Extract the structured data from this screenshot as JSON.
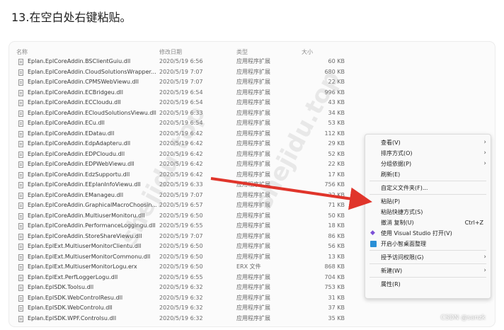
{
  "heading": "13.在空白处右键粘贴。",
  "columns": {
    "name": "名称",
    "date": "修改日期",
    "type": "类型",
    "size": "大小"
  },
  "files": [
    {
      "name": "Eplan.EplCoreAddin.BSClientGuiu.dll",
      "date": "2020/5/19 6:56",
      "type": "应用程序扩展",
      "size": "60 KB"
    },
    {
      "name": "Eplan.EplCoreAddin.CloudSolutionsWrapper...",
      "date": "2020/5/19 7:07",
      "type": "应用程序扩展",
      "size": "680 KB"
    },
    {
      "name": "Eplan.EplCoreAddin.CPMSWebViewu.dll",
      "date": "2020/5/19 7:07",
      "type": "应用程序扩展",
      "size": "22 KB"
    },
    {
      "name": "Eplan.EplCoreAddin.ECBridgeu.dll",
      "date": "2020/5/19 6:54",
      "type": "应用程序扩展",
      "size": "996 KB"
    },
    {
      "name": "Eplan.EplCoreAddin.ECCloudu.dll",
      "date": "2020/5/19 6:54",
      "type": "应用程序扩展",
      "size": "43 KB"
    },
    {
      "name": "Eplan.EplCoreAddin.ECloudSolutionsViewu.dll",
      "date": "2020/5/19 6:33",
      "type": "应用程序扩展",
      "size": "34 KB"
    },
    {
      "name": "Eplan.EplCoreAddin.ECu.dll",
      "date": "2020/5/19 6:54",
      "type": "应用程序扩展",
      "size": "53 KB"
    },
    {
      "name": "Eplan.EplCoreAddin.EDatau.dll",
      "date": "2020/5/19 6:42",
      "type": "应用程序扩展",
      "size": "112 KB"
    },
    {
      "name": "Eplan.EplCoreAddin.EdpAdapteru.dll",
      "date": "2020/5/19 6:42",
      "type": "应用程序扩展",
      "size": "29 KB"
    },
    {
      "name": "Eplan.EplCoreAddin.EDPCloudu.dll",
      "date": "2020/5/19 6:42",
      "type": "应用程序扩展",
      "size": "52 KB"
    },
    {
      "name": "Eplan.EplCoreAddin.EDPWebViewu.dll",
      "date": "2020/5/19 6:42",
      "type": "应用程序扩展",
      "size": "22 KB"
    },
    {
      "name": "Eplan.EplCoreAddin.EdzSupportu.dll",
      "date": "2020/5/19 6:42",
      "type": "应用程序扩展",
      "size": "17 KB"
    },
    {
      "name": "Eplan.EplCoreAddin.EEplanInfoViewu.dll",
      "date": "2020/5/19 6:33",
      "type": "应用程序扩展",
      "size": "756 KB"
    },
    {
      "name": "Eplan.EplCoreAddin.EManageu.dll",
      "date": "2020/5/19 7:07",
      "type": "应用程序扩展",
      "size": "32 KB"
    },
    {
      "name": "Eplan.EplCoreAddin.GraphicalMacroChoosin...",
      "date": "2020/5/19 6:57",
      "type": "应用程序扩展",
      "size": "71 KB"
    },
    {
      "name": "Eplan.EplCoreAddin.MultiuserMonitoru.dll",
      "date": "2020/5/19 6:50",
      "type": "应用程序扩展",
      "size": "50 KB"
    },
    {
      "name": "Eplan.EplCoreAddin.PerformanceLoggingu.dll",
      "date": "2020/5/19 6:55",
      "type": "应用程序扩展",
      "size": "18 KB"
    },
    {
      "name": "Eplan.EplCoreAddin.StoreShareViewu.dll",
      "date": "2020/5/19 7:07",
      "type": "应用程序扩展",
      "size": "86 KB"
    },
    {
      "name": "Eplan.EplExt.MultiuserMonitorClientu.dll",
      "date": "2020/5/19 6:50",
      "type": "应用程序扩展",
      "size": "56 KB"
    },
    {
      "name": "Eplan.EplExt.MultiuserMonitorCommonu.dll",
      "date": "2020/5/19 6:50",
      "type": "应用程序扩展",
      "size": "13 KB"
    },
    {
      "name": "Eplan.EplExt.MultiuserMonitorLogu.erx",
      "date": "2020/5/19 6:50",
      "type": "ERX 文件",
      "size": "868 KB"
    },
    {
      "name": "Eplan.EplExt.PerfLoggerLogu.dll",
      "date": "2020/5/19 6:55",
      "type": "应用程序扩展",
      "size": "704 KB"
    },
    {
      "name": "Eplan.EplSDK.Toolsu.dll",
      "date": "2020/5/19 6:32",
      "type": "应用程序扩展",
      "size": "753 KB"
    },
    {
      "name": "Eplan.EplSDK.WebControlResu.dll",
      "date": "2020/5/19 6:32",
      "type": "应用程序扩展",
      "size": "31 KB"
    },
    {
      "name": "Eplan.EplSDK.WebControlu.dll",
      "date": "2020/5/19 6:32",
      "type": "应用程序扩展",
      "size": "37 KB"
    },
    {
      "name": "Eplan.EplSDK.WPF.Controlsu.dll",
      "date": "2020/5/19 6:32",
      "type": "应用程序扩展",
      "size": "35 KB"
    }
  ],
  "context_menu": [
    {
      "label": "查看(V)",
      "submenu": true
    },
    {
      "label": "排序方式(O)",
      "submenu": true
    },
    {
      "label": "分组依据(P)",
      "submenu": true
    },
    {
      "label": "刷新(E)"
    },
    {
      "separator": true
    },
    {
      "label": "自定义文件夹(F)..."
    },
    {
      "separator": true
    },
    {
      "label": "粘贴(P)"
    },
    {
      "label": "粘贴快捷方式(S)"
    },
    {
      "label": "撤消 复制(U)",
      "shortcut": "Ctrl+Z"
    },
    {
      "label": "使用 Visual Studio 打开(V)",
      "icon": "visual-studio-icon"
    },
    {
      "label": "开启小智桌面整理",
      "icon": "desktop-organizer-icon"
    },
    {
      "separator": true
    },
    {
      "label": "授予访问权限(G)",
      "submenu": true
    },
    {
      "separator": true
    },
    {
      "label": "新建(W)",
      "submenu": true
    },
    {
      "separator": true
    },
    {
      "label": "属性(R)"
    }
  ],
  "watermark_text": "shejidu.top",
  "credit": "CSDN @sanzk",
  "colors": {
    "arrow": "#e0352b",
    "vs_purple": "#7b4fd6",
    "organizer": "#2a8fd6"
  }
}
